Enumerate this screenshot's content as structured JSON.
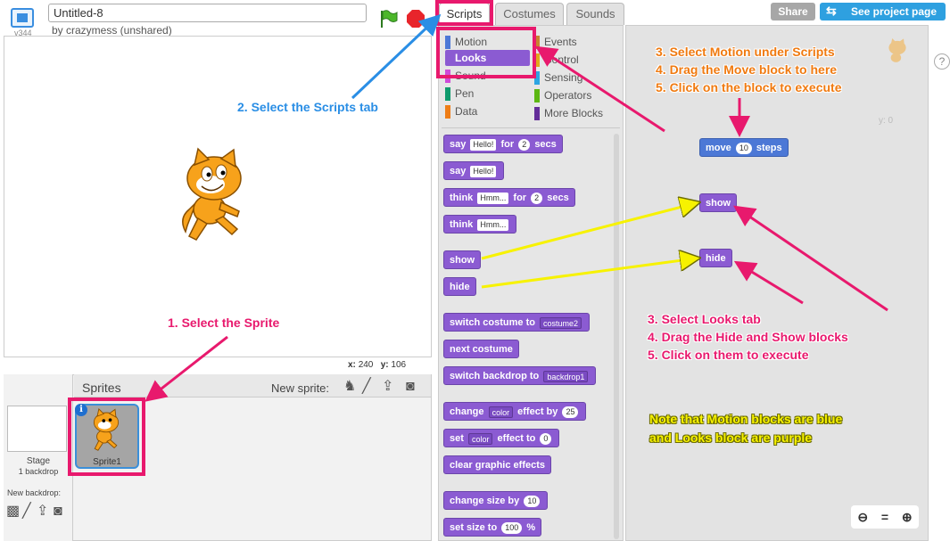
{
  "stage_bar": {
    "version": "v344",
    "project_title": "Untitled-8",
    "author": "by crazymess (unshared)"
  },
  "stage": {
    "x_label": "x:",
    "x_value": "240",
    "y_label": "y:",
    "y_value": "106"
  },
  "sprites_pane": {
    "title": "Sprites",
    "new_sprite_label": "New sprite:",
    "stage_label": "Stage",
    "backdrop_count": "1 backdrop",
    "new_backdrop_label": "New backdrop:",
    "sprite_name": "Sprite1"
  },
  "tabs": {
    "scripts": "Scripts",
    "costumes": "Costumes",
    "sounds": "Sounds"
  },
  "header_buttons": {
    "share": "Share",
    "see_project": "See project page"
  },
  "categories": {
    "left": [
      {
        "label": "Motion",
        "color": "#4c78d6"
      },
      {
        "label": "Looks",
        "color": "#8b5bd2"
      },
      {
        "label": "Sound",
        "color": "#cf4ad9"
      },
      {
        "label": "Pen",
        "color": "#0e9a6c"
      },
      {
        "label": "Data",
        "color": "#ee7d16"
      }
    ],
    "right": [
      {
        "label": "Events",
        "color": "#c88330"
      },
      {
        "label": "Control",
        "color": "#e1a91a"
      },
      {
        "label": "Sensing",
        "color": "#2ca5e2"
      },
      {
        "label": "Operators",
        "color": "#5cb712"
      },
      {
        "label": "More Blocks",
        "color": "#632d99"
      }
    ]
  },
  "palette_blocks": {
    "say_for": {
      "text1": "say",
      "slot": "Hello!",
      "text2": "for",
      "num": "2",
      "text3": "secs"
    },
    "say": {
      "text1": "say",
      "slot": "Hello!"
    },
    "think_for": {
      "text1": "think",
      "slot": "Hmm...",
      "text2": "for",
      "num": "2",
      "text3": "secs"
    },
    "think": {
      "text1": "think",
      "slot": "Hmm..."
    },
    "show": "show",
    "hide": "hide",
    "switch_costume": {
      "text1": "switch costume to",
      "drop": "costume2"
    },
    "next_costume": "next costume",
    "switch_backdrop": {
      "text1": "switch backdrop to",
      "drop": "backdrop1"
    },
    "change_effect": {
      "text1": "change",
      "drop": "color",
      "text2": "effect by",
      "num": "25"
    },
    "set_effect": {
      "text1": "set",
      "drop": "color",
      "text2": "effect to",
      "num": "0"
    },
    "clear_effects": "clear graphic effects",
    "change_size": {
      "text1": "change size by",
      "num": "10"
    },
    "set_size": {
      "text1": "set size to",
      "num": "100",
      "text2": "%"
    }
  },
  "script_blocks": {
    "move": {
      "text1": "move",
      "num": "10",
      "text2": "steps"
    },
    "show": "show",
    "hide": "hide"
  },
  "script_area": {
    "help": "?",
    "sprite_y": "y: 0"
  },
  "annotations": {
    "step1": "1. Select the Sprite",
    "step2": "2. Select the Scripts tab",
    "motion_steps": [
      "3. Select Motion under Scripts",
      "4. Drag the Move block to here",
      "5. Click on the block to execute"
    ],
    "looks_steps": [
      "3. Select Looks tab",
      "4. Drag the Hide and Show blocks",
      "5. Click on them to execute"
    ],
    "note": [
      "Note that Motion blocks are blue",
      "and Looks block are purple"
    ]
  },
  "colors": {
    "motion": "#4c78d6",
    "looks": "#8b5bd2",
    "annotation_pink": "#e8196d",
    "annotation_blue": "#2a8ee5",
    "annotation_orange": "#f07a10",
    "annotation_yellow": "#f7f200"
  }
}
